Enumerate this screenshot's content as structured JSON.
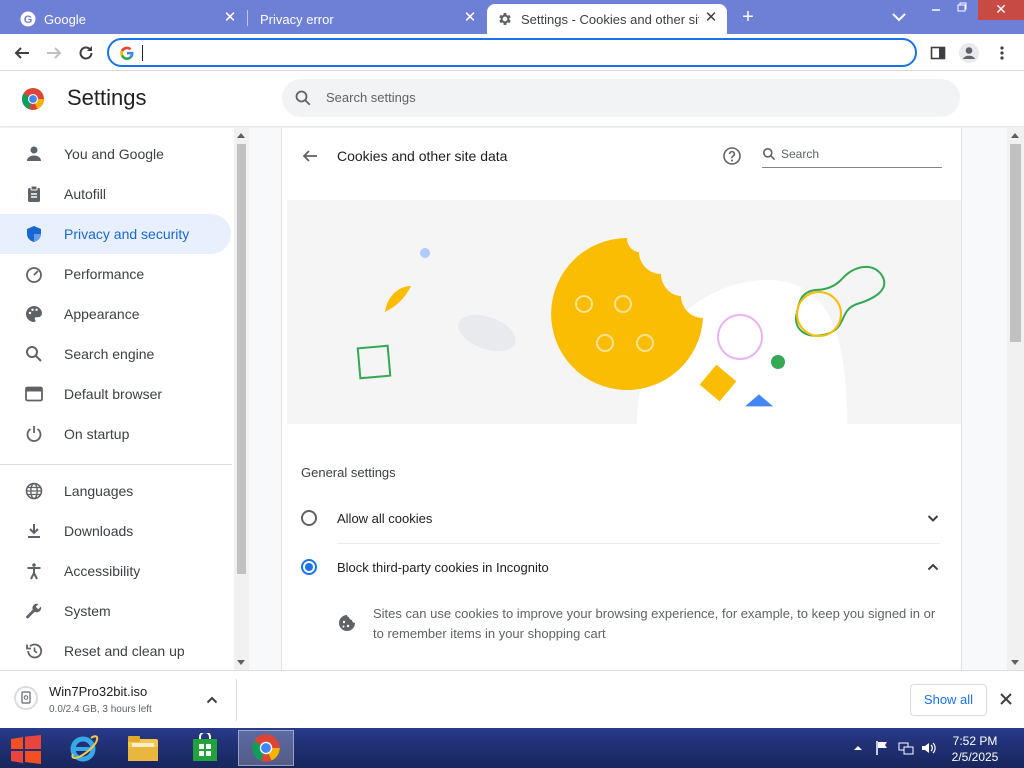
{
  "browser": {
    "tabs": [
      {
        "label": "Google",
        "icon": "google-g-icon",
        "active": false
      },
      {
        "label": "Privacy error",
        "icon": "none",
        "active": false
      },
      {
        "label": "Settings - Cookies and other site",
        "icon": "gear-icon",
        "active": true
      }
    ],
    "omnibox": {
      "value": "",
      "placeholder": ""
    },
    "window_close_glyph": "✕",
    "colors": {
      "tabstrip": "#6e7fd6",
      "accent": "#1a73e8",
      "active_nav_bg": "#e8f0fe"
    }
  },
  "settings": {
    "title": "Settings",
    "search_placeholder": "Search settings"
  },
  "sidebar": {
    "items": [
      {
        "label": "You and Google",
        "icon": "person-icon",
        "active": false
      },
      {
        "label": "Autofill",
        "icon": "clipboard-icon",
        "active": false
      },
      {
        "label": "Privacy and security",
        "icon": "shield-icon",
        "active": true
      },
      {
        "label": "Performance",
        "icon": "speedometer-icon",
        "active": false
      },
      {
        "label": "Appearance",
        "icon": "palette-icon",
        "active": false
      },
      {
        "label": "Search engine",
        "icon": "search-icon",
        "active": false
      },
      {
        "label": "Default browser",
        "icon": "browser-window-icon",
        "active": false
      },
      {
        "label": "On startup",
        "icon": "power-icon",
        "active": false
      },
      {
        "label": "Languages",
        "icon": "globe-icon",
        "active": false
      },
      {
        "label": "Downloads",
        "icon": "download-icon",
        "active": false
      },
      {
        "label": "Accessibility",
        "icon": "accessibility-icon",
        "active": false
      },
      {
        "label": "System",
        "icon": "wrench-icon",
        "active": false
      },
      {
        "label": "Reset and clean up",
        "icon": "reset-history-icon",
        "active": false
      }
    ]
  },
  "page": {
    "title": "Cookies and other site data",
    "search_placeholder": "Search",
    "section_label": "General settings",
    "options": [
      {
        "label": "Allow all cookies",
        "checked": false,
        "expanded": false
      },
      {
        "label": "Block third-party cookies in Incognito",
        "checked": true,
        "expanded": true
      }
    ],
    "description": "Sites can use cookies to improve your browsing experience, for example, to keep you signed in or to remember items in your shopping cart"
  },
  "download": {
    "file_name": "Win7Pro32bit.iso",
    "status": "0.0/2.4 GB, 3 hours left",
    "show_all_label": "Show all"
  },
  "taskbar": {
    "time": "7:52 PM",
    "date": "2/5/2025",
    "apps": [
      "internet-explorer-icon",
      "file-explorer-icon",
      "store-icon",
      "chrome-icon"
    ]
  }
}
